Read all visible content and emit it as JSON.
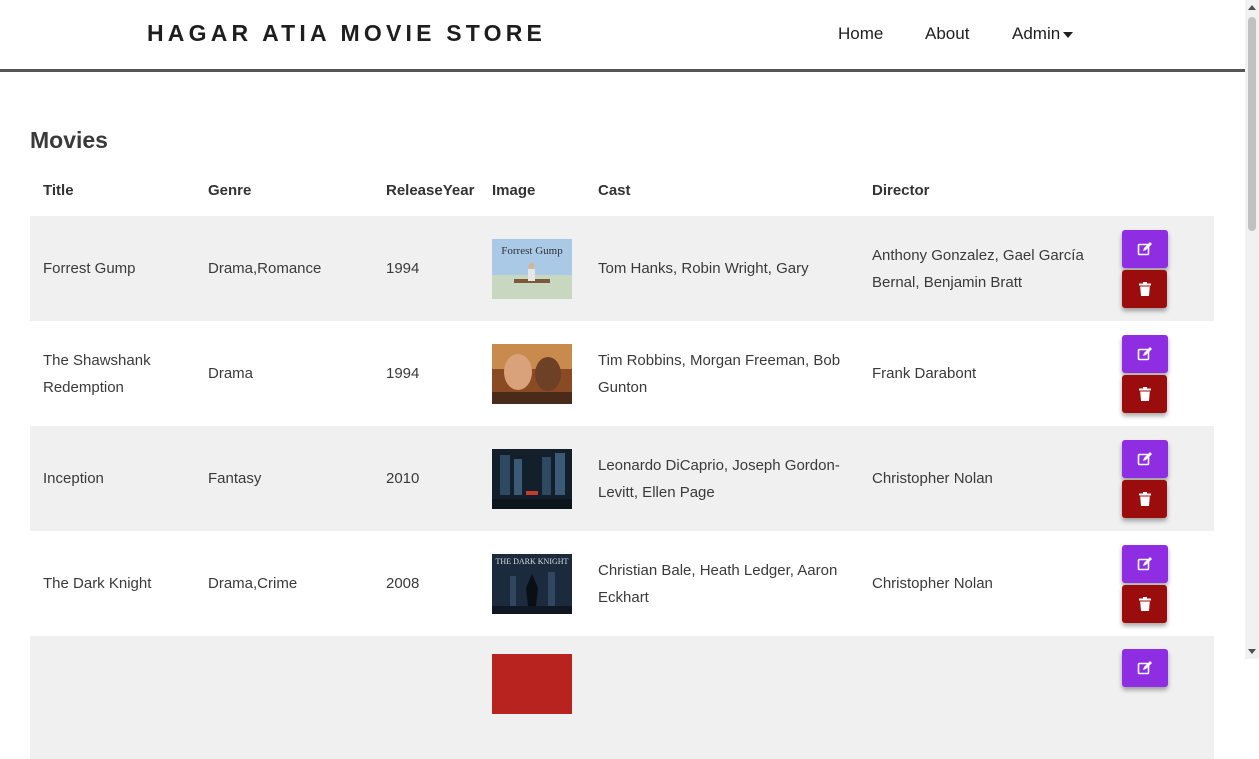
{
  "nav": {
    "brand": "HAGAR ATIA MOVIE STORE",
    "links": [
      "Home",
      "About",
      "Admin"
    ]
  },
  "page": {
    "title": "Movies"
  },
  "table": {
    "headers": [
      "Title",
      "Genre",
      "ReleaseYear",
      "Image",
      "Cast",
      "Director"
    ],
    "rows": [
      {
        "title": "Forrest Gump",
        "genre": "Drama,Romance",
        "year": "1994",
        "poster": "Forrest Gump",
        "cast": "Tom Hanks, Robin Wright, Gary",
        "director": "Anthony Gonzalez, Gael García Bernal, Benjamin Bratt"
      },
      {
        "title": "The Shawshank Redemption",
        "genre": "Drama",
        "year": "1994",
        "poster": "",
        "cast": "Tim Robbins, Morgan Freeman, Bob Gunton",
        "director": "Frank Darabont"
      },
      {
        "title": "Inception",
        "genre": "Fantasy",
        "year": "2010",
        "poster": "",
        "cast": "Leonardo DiCaprio, Joseph Gordon-Levitt, Ellen Page",
        "director": "Christopher Nolan"
      },
      {
        "title": "The Dark Knight",
        "genre": "Drama,Crime",
        "year": "2008",
        "poster": "THE DARK KNIGHT",
        "cast": "Christian Bale, Heath Ledger, Aaron Eckhart",
        "director": "Christopher Nolan"
      }
    ]
  },
  "colors": {
    "edit": "#8e2de2",
    "delete": "#9b0d0d",
    "row_stripe": "#f0f0f0"
  },
  "icons": {
    "edit": "edit-icon",
    "delete": "trash-icon"
  }
}
